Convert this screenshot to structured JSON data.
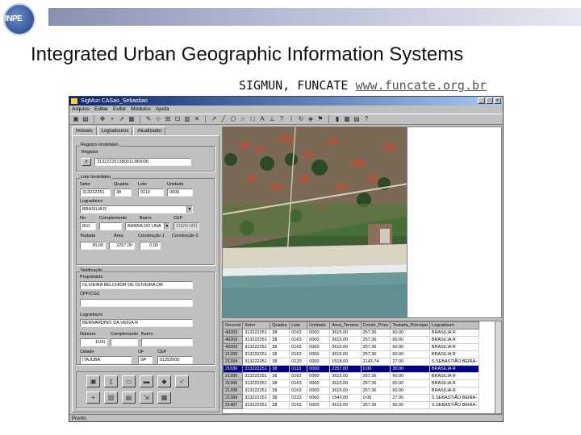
{
  "slide": {
    "title": "Integrated Urban Geographic Information Systems",
    "subtitle_prefix": "SIGMUN, FUNCATE ",
    "subtitle_link": "www.funcate.org.br",
    "logo_text": "INPE",
    "colors": {
      "band_start": "#8a8fb0",
      "band_end": "#e6e7f0",
      "logo_blue": "#1d3f86"
    }
  },
  "window": {
    "title": "SigMun CASao_Sebastiao",
    "controls": [
      "_",
      "□",
      "x"
    ],
    "menu": [
      "Arquivo",
      "Editar",
      "Exibir",
      "Módulos",
      "Ajuda"
    ],
    "status": "Pronto",
    "tabs": [
      "Imóveis",
      "Logradouros",
      "Atualizador"
    ],
    "form": {
      "registro_group": "Registro Imobiliário",
      "registro_label": "Registro",
      "registro_value": "313222251380011380000",
      "lote_group": "Lote Imobiliário",
      "setor_label": "Setor",
      "setor_value": "313222251",
      "quadra_label": "Quadra",
      "quadra_value": "38",
      "lote_label": "Lote",
      "lote_value": "0113",
      "unidade_label": "Unidade",
      "unidade_value": "0000",
      "logradouro_label": "Logradouro",
      "logradouro_value": "BRASILIA R",
      "no_label": "No",
      "no_value": "810",
      "complemento_label": "Complemento",
      "bairro_label": "Bairro",
      "bairro_value": "BARRA DO UNA",
      "cep_label": "CEP",
      "cep_value": "11600-000",
      "testada_label": "Testada",
      "testada_value": "30,00",
      "area_label": "Área",
      "area_value": "2257,00",
      "construcao1_label": "Construção 1",
      "construcao1_value": "0,00",
      "construcao2_label": "Construção 2",
      "notif_group": "Notificação",
      "proprietario_label": "Proprietário",
      "proprietario_value": "OLIVEIRA BELCHIOR DE OLIVEIRA DR",
      "cpf_label": "CPF/CGC",
      "cpf_value": "",
      "logradouro2_label": "Logradouro",
      "logradouro2_value": "BERNARDINO DA VEIGA R",
      "numero_label": "Número",
      "numero_value": "1100",
      "complemento2_label": "Complemento",
      "bairro2_label": "Bairro",
      "cidade_label": "Cidade",
      "cidade_value": "ITAJUBÁ",
      "uf_label": "UF",
      "uf_value": "SP",
      "cep2_label": "CEP",
      "cep2_value": "01252000"
    }
  },
  "table": {
    "columns": [
      "Geocod",
      "Setor",
      "Quadra",
      "Lote",
      "Unidade",
      "Area_Terreno",
      "Constr_Princ",
      "Testada_Principal",
      "Logradouro"
    ],
    "rows": [
      [
        "40203",
        "313222251",
        "38",
        "0163",
        "0000",
        "3615.00",
        "257.36",
        "60.00",
        "BRASILIA R"
      ],
      [
        "40203",
        "313222251",
        "38",
        "0163",
        "0000",
        "3615.00",
        "257.36",
        "60.00",
        "BRASILIA R"
      ],
      [
        "40203",
        "313222251",
        "38",
        "0163",
        "0000",
        "3615.00",
        "257.36",
        "60.00",
        "BRASILIA R"
      ],
      [
        "21399",
        "313222251",
        "38",
        "0163",
        "0000",
        "3615.00",
        "257.36",
        "60.00",
        "BRASILIA R"
      ],
      [
        "21394",
        "313222251",
        "38",
        "0120",
        "0000",
        "1518.00",
        "2143.74",
        "27.00",
        "S.SEBASTIÃO BEIRA-"
      ],
      [
        "21036",
        "313222251",
        "38",
        "0113",
        "0000",
        "2257.00",
        "0.00",
        "30.00",
        "BRASILIA R"
      ],
      [
        "21395",
        "313222251",
        "38",
        "0163",
        "0000",
        "3615.00",
        "257.36",
        "60.00",
        "BRASILIA R"
      ],
      [
        "21396",
        "313222251",
        "38",
        "0163",
        "0000",
        "3615.00",
        "257.36",
        "60.00",
        "BRASILIA R"
      ],
      [
        "21398",
        "313222251",
        "38",
        "0163",
        "0000",
        "3615.00",
        "257.36",
        "60.00",
        "BRASILIA R"
      ],
      [
        "21399",
        "313222251",
        "38",
        "0223",
        "0000",
        "1543.00",
        "0.00",
        "27.00",
        "S.SEBASTIÃO BEIRA-"
      ],
      [
        "21407",
        "313222251",
        "38",
        "0163",
        "0000",
        "3615.00",
        "257.36",
        "60.00",
        "S.SEBASTIÃO BEIRA-"
      ]
    ],
    "highlighted_row": 5
  }
}
